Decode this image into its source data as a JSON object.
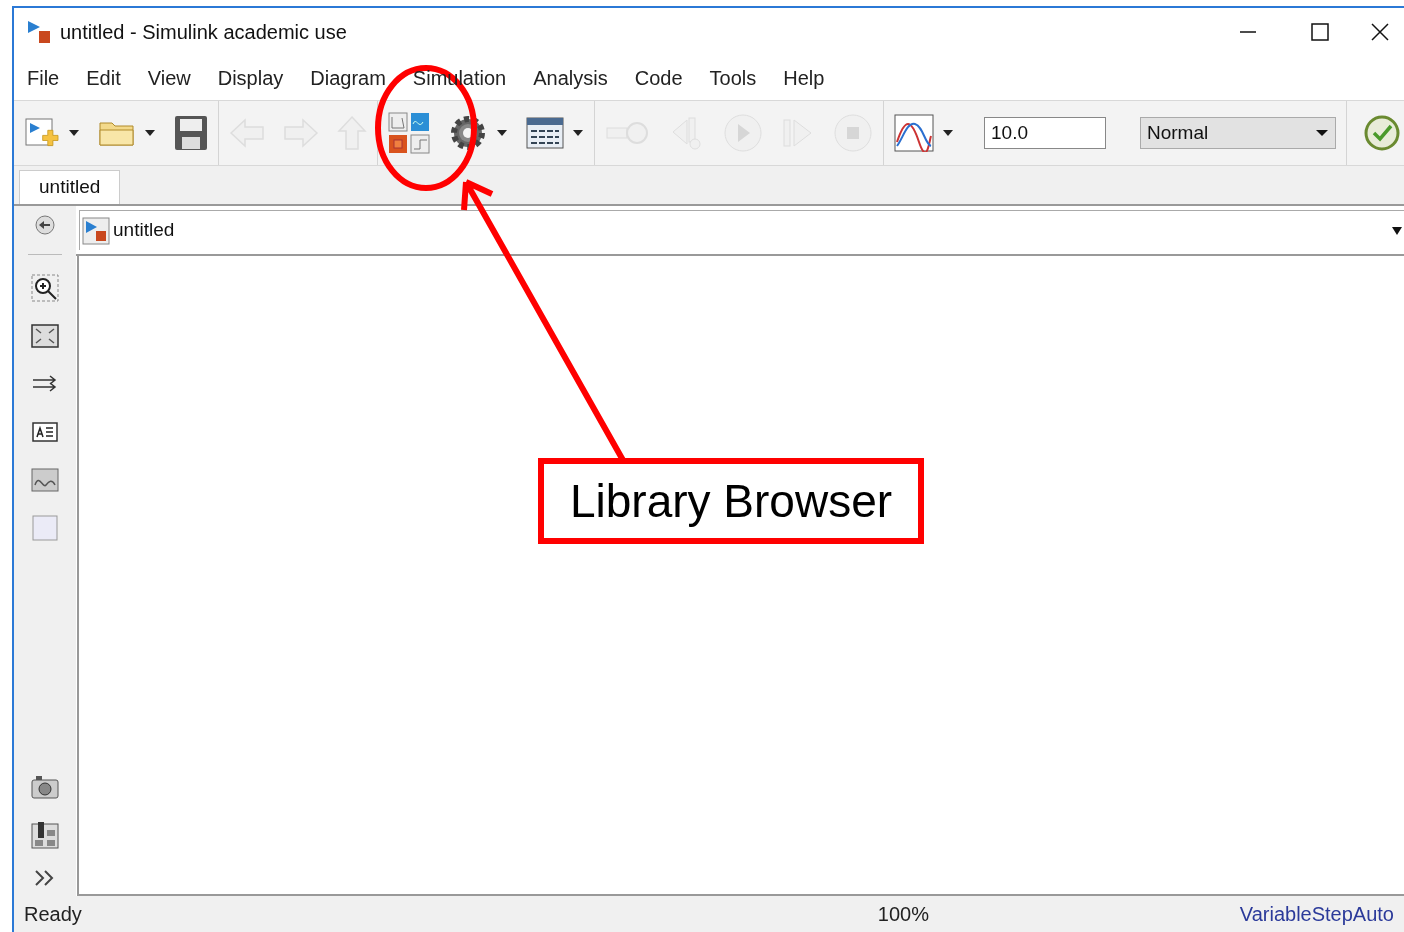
{
  "window": {
    "title": "untitled - Simulink academic use"
  },
  "menu": [
    "File",
    "Edit",
    "View",
    "Display",
    "Diagram",
    "Simulation",
    "Analysis",
    "Code",
    "Tools",
    "Help"
  ],
  "toolbar": [
    {
      "kind": "new-model",
      "disabled": false
    },
    {
      "kind": "open",
      "disabled": false
    },
    {
      "kind": "save",
      "disabled": false
    },
    {
      "kind": "back",
      "disabled": true
    },
    {
      "kind": "forward",
      "disabled": true
    },
    {
      "kind": "up",
      "disabled": true
    },
    {
      "kind": "library",
      "disabled": false
    },
    {
      "kind": "settings",
      "disabled": false
    },
    {
      "kind": "explorer",
      "disabled": false
    },
    {
      "kind": "link",
      "disabled": true
    },
    {
      "kind": "step-back",
      "disabled": true
    },
    {
      "kind": "run",
      "disabled": true
    },
    {
      "kind": "step-forward",
      "disabled": true
    },
    {
      "kind": "stop",
      "disabled": true
    },
    {
      "kind": "scope",
      "disabled": false
    }
  ],
  "stop_time": {
    "value": "10.0"
  },
  "sim_mode": {
    "value": "Normal"
  },
  "tabs": [
    {
      "label": "untitled",
      "selected": true
    }
  ],
  "address": {
    "path": "untitled"
  },
  "status_bar": {
    "state": "Ready",
    "zoom": "100%",
    "solver": "VariableStepAuto"
  },
  "annotation": {
    "label": "Library Browser"
  }
}
